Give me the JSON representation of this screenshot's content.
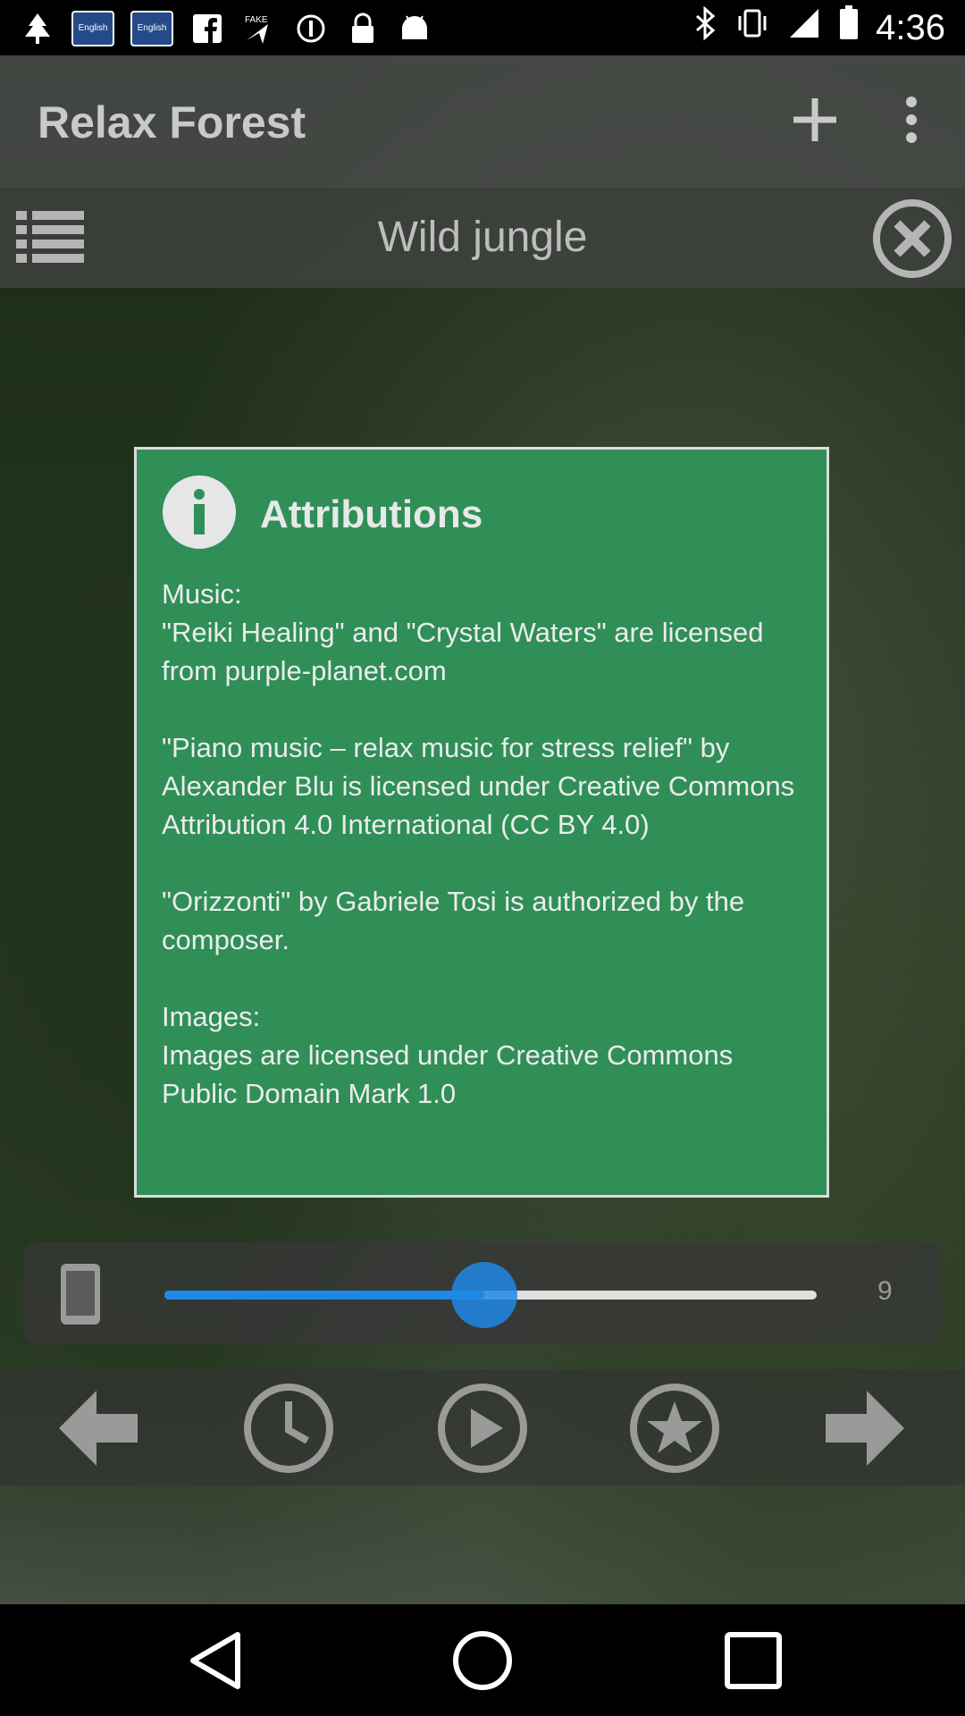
{
  "status_bar": {
    "keyboard_badge_1": "English",
    "keyboard_badge_2": "English",
    "time": "4:36"
  },
  "app_bar": {
    "title": "Relax Forest"
  },
  "track_bar": {
    "title": "Wild jungle"
  },
  "dialog": {
    "title": "Attributions",
    "body": "Music:\n\"Reiki Healing\" and \"Crystal Waters\" are licensed from purple-planet.com\n\n\"Piano music – relax music for stress relief\" by Alexander Blu is licensed under Creative Commons Attribution 4.0 International (CC BY 4.0)\n\n\"Orizzonti\" by Gabriele Tosi is authorized by the composer.\n\nImages:\nImages are licensed under Creative Commons Public Domain Mark 1.0"
  },
  "volume": {
    "value_label": "9",
    "level_fraction": 0.49
  },
  "controls": [
    "arrow-left-icon",
    "clock-icon",
    "play-icon",
    "star-icon",
    "arrow-right-icon"
  ],
  "colors": {
    "dialog_bg": "#2f8f57",
    "accent": "#1e88e5"
  }
}
